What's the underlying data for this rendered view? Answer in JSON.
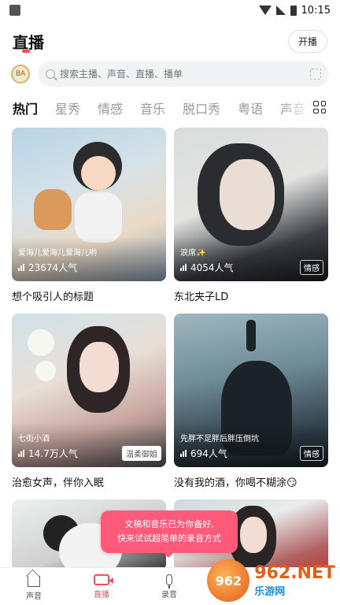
{
  "status_bar": {
    "time": "10:15"
  },
  "header": {
    "title": "直播",
    "start_live_label": "开播"
  },
  "search": {
    "placeholder": "搜索主播、声音、直播、播单",
    "rank_badge": "BA"
  },
  "tabs": [
    "热门",
    "星秀",
    "情感",
    "音乐",
    "脱口秀",
    "粤语",
    "声音"
  ],
  "cards": [
    {
      "title": "想个吸引人的标题",
      "tagline": "爱海儿爱海儿爱海儿哟",
      "viewers": "23674人气",
      "tag": ""
    },
    {
      "title": "东北夹子LD",
      "tagline": "浪席✨",
      "viewers": "4054人气",
      "tag": "情感"
    },
    {
      "title": "治愈女声，伴你入眠",
      "tagline": "七街小酒",
      "viewers": "14.7万人气",
      "tag": "温柔御姐"
    },
    {
      "title": "没有我的酒，你喝不糊涂😏",
      "tagline": "先胖不足胖后胖压倒坑",
      "viewers": "694人气",
      "tag": "情感"
    },
    {
      "title": "",
      "tagline": "",
      "viewers": "",
      "tag": ""
    },
    {
      "title": "",
      "tagline": "",
      "viewers": "",
      "tag": ""
    }
  ],
  "toast": {
    "line1": "文稿和音乐已为你备好,",
    "line2": "快来试试超简单的录音方式"
  },
  "bottom_nav": [
    {
      "label": "声音",
      "icon": "home-icon"
    },
    {
      "label": "直播",
      "icon": "video-camera-icon"
    },
    {
      "label": "录音",
      "icon": "microphone-icon"
    }
  ],
  "watermark": {
    "logo_text": "962",
    "domain": "962.NET",
    "site_name": "乐游网"
  },
  "colors": {
    "accent": "#ff4b5b",
    "toast_bg": "#ff5a7a"
  }
}
